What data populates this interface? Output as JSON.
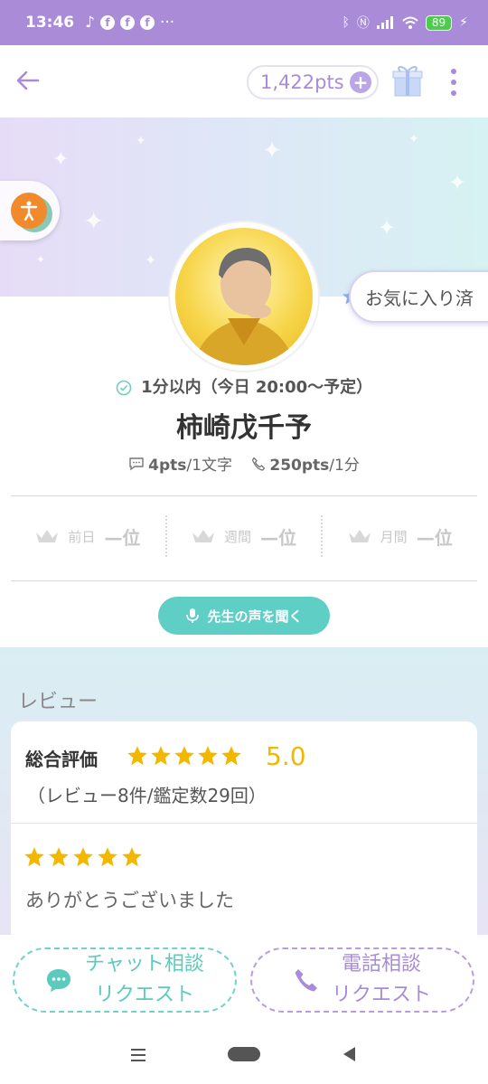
{
  "status_bar": {
    "time": "13:46",
    "notification_icons": [
      "f",
      "f",
      "f"
    ],
    "more": "···",
    "battery": "89"
  },
  "header": {
    "points": "1,422pts",
    "points_add": "+"
  },
  "profile": {
    "availability": "1分以内（今日 20:00〜予定）",
    "name": "柿崎戊千予",
    "chat_price_value": "4pts",
    "chat_price_unit": "/1文字",
    "call_price_value": "250pts",
    "call_price_unit": "/1分",
    "favorite_label": "お気に入り済"
  },
  "ranking": [
    {
      "period": "前日",
      "rank": "—位"
    },
    {
      "period": "週間",
      "rank": "—位"
    },
    {
      "period": "月間",
      "rank": "—位"
    }
  ],
  "voice_button": "先生の声を聞く",
  "reviews": {
    "heading": "レビュー",
    "overall_label": "総合評価",
    "overall_stars": 5,
    "overall_score": "5.0",
    "counts": "（レビュー8件/鑑定数29回）",
    "first_review_stars": 5,
    "first_review_text": "ありがとうございました"
  },
  "actions": {
    "chat_line1": "チャット相談",
    "chat_line2": "リクエスト",
    "call_line1": "電話相談",
    "call_line2": "リクエスト"
  },
  "colors": {
    "accent": "#a98bd8",
    "teal": "#5fcfc5",
    "star": "#f2b800"
  }
}
